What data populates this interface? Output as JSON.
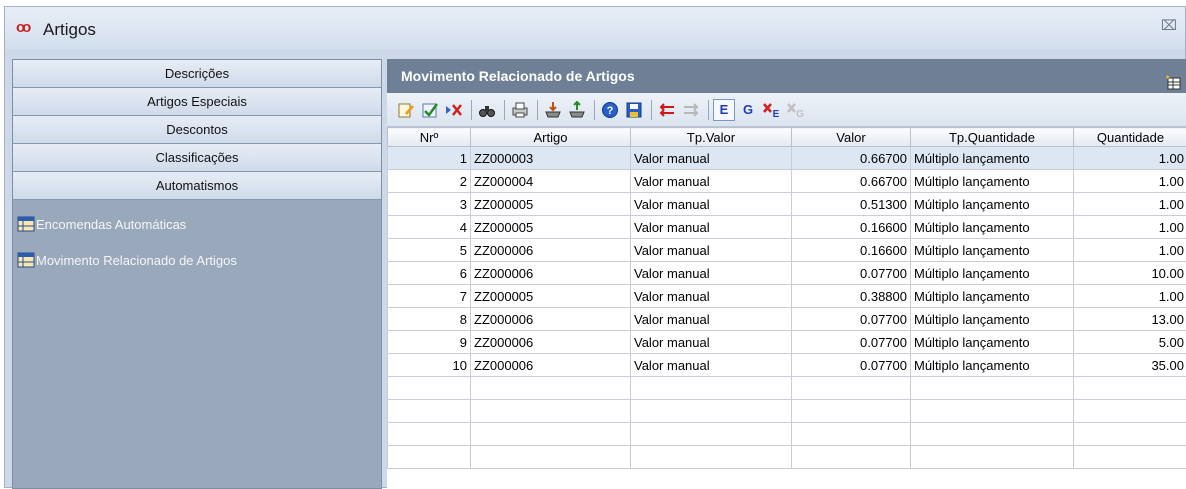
{
  "window": {
    "title": "Artigos",
    "close_glyph": "⌧"
  },
  "sidebar": {
    "buttons": [
      "Descrições",
      "Artigos Especiais",
      "Descontos",
      "Classificações",
      "Automatismos"
    ],
    "items": [
      {
        "label": "Encomendas Automáticas",
        "icon": "table-icon"
      },
      {
        "label": "Movimento Relacionado de Artigos",
        "icon": "table-icon"
      }
    ]
  },
  "main": {
    "header": "Movimento Relacionado de Artigos",
    "toolbar": {
      "letter_e": "E",
      "letter_g": "G",
      "icons": [
        "edit-icon",
        "check-icon",
        "delete-icon",
        "find-icon",
        "print-icon",
        "import-icon",
        "export-icon",
        "help-icon",
        "save-icon",
        "move-left-icon",
        "move-right-icon",
        "e-icon",
        "g-icon",
        "delete-e-icon",
        "delete-g-icon"
      ]
    },
    "table": {
      "columns": [
        "Nrº",
        "Artigo",
        "Tp.Valor",
        "Valor",
        "Tp.Quantidade",
        "Quantidade"
      ],
      "rows": [
        [
          "1",
          "ZZ000003",
          "Valor manual",
          "0.66700",
          "Múltiplo lançamento",
          "1.00"
        ],
        [
          "2",
          "ZZ000004",
          "Valor manual",
          "0.66700",
          "Múltiplo lançamento",
          "1.00"
        ],
        [
          "3",
          "ZZ000005",
          "Valor manual",
          "0.51300",
          "Múltiplo lançamento",
          "1.00"
        ],
        [
          "4",
          "ZZ000005",
          "Valor manual",
          "0.16600",
          "Múltiplo lançamento",
          "1.00"
        ],
        [
          "5",
          "ZZ000006",
          "Valor manual",
          "0.16600",
          "Múltiplo lançamento",
          "1.00"
        ],
        [
          "6",
          "ZZ000006",
          "Valor manual",
          "0.07700",
          "Múltiplo lançamento",
          "10.00"
        ],
        [
          "7",
          "ZZ000005",
          "Valor manual",
          "0.38800",
          "Múltiplo lançamento",
          "1.00"
        ],
        [
          "8",
          "ZZ000006",
          "Valor manual",
          "0.07700",
          "Múltiplo lançamento",
          "13.00"
        ],
        [
          "9",
          "ZZ000006",
          "Valor manual",
          "0.07700",
          "Múltiplo lançamento",
          "5.00"
        ],
        [
          "10",
          "ZZ000006",
          "Valor manual",
          "0.07700",
          "Múltiplo lançamento",
          "35.00"
        ]
      ],
      "selected_row": 0
    }
  }
}
